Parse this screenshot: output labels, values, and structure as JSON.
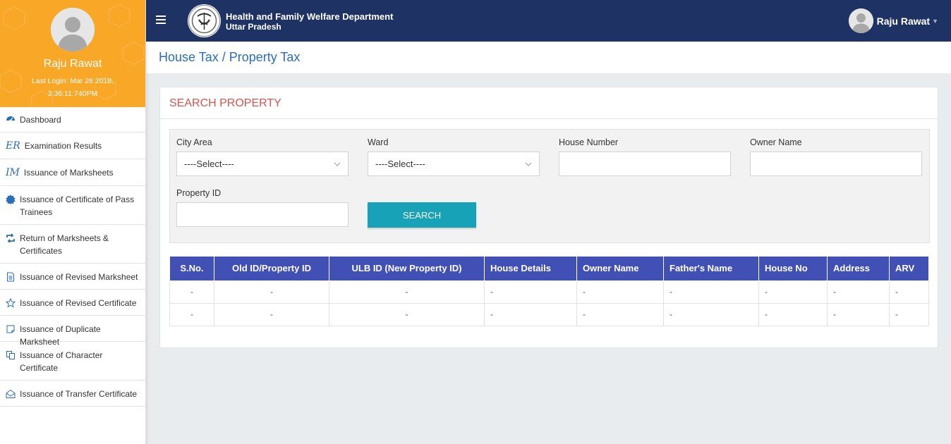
{
  "user": {
    "name": "Raju Rawat",
    "last_login": "Last Login: Mar 28 2018, 3:36:11:740PM"
  },
  "sidebar": {
    "items": [
      {
        "label": "Dashboard",
        "icon": "dashboard-icon"
      },
      {
        "label": "Examination Results",
        "icon": "er-icon",
        "icon_text": "ER"
      },
      {
        "label": "Issuance of Marksheets",
        "icon": "im-icon",
        "icon_text": "IM"
      },
      {
        "label": "Issuance of Certificate of Pass Trainees",
        "icon": "badge-icon"
      },
      {
        "label": "Return of Marksheets & Certificates",
        "icon": "retweet-icon"
      },
      {
        "label": "Issuance of Revised Marksheet",
        "icon": "document-icon"
      },
      {
        "label": "Issuance of Revised Certificate",
        "icon": "star-icon"
      },
      {
        "label": "Issuance of Duplicate Marksheet",
        "icon": "note-icon"
      },
      {
        "label": "Issuance of Character Certificate",
        "icon": "copy-icon"
      },
      {
        "label": "Issuance of Transfer Certificate",
        "icon": "envelope-open-icon"
      }
    ]
  },
  "header": {
    "dept_line1": "Health and Family Welfare Department",
    "dept_line2": "Uttar Pradesh"
  },
  "page": {
    "title": "House Tax / Property Tax"
  },
  "search": {
    "title": "SEARCH PROPERTY",
    "city_area_label": "City Area",
    "city_area_value": "----Select----",
    "ward_label": "Ward",
    "ward_value": "----Select----",
    "house_number_label": "House Number",
    "house_number_value": "",
    "owner_name_label": "Owner Name",
    "owner_name_value": "",
    "property_id_label": "Property ID",
    "property_id_value": "",
    "button_label": "SEARCH"
  },
  "table": {
    "headers": [
      "S.No.",
      "Old ID/Property ID",
      "ULB ID (New Property ID)",
      "House Details",
      "Owner Name",
      "Father's Name",
      "House No",
      "Address",
      "ARV"
    ],
    "rows": [
      [
        "-",
        "-",
        "-",
        "-",
        "-",
        "-",
        "-",
        "-",
        "-"
      ],
      [
        "-",
        "-",
        "-",
        "-",
        "-",
        "-",
        "-",
        "-",
        "-"
      ]
    ]
  },
  "colors": {
    "sidebar_profile_bg": "#f9a727",
    "topbar_bg": "#1e3364",
    "accent_blue": "#2a6ebb",
    "search_title": "#d9534f",
    "button_bg": "#17a2b8",
    "table_header_bg": "#4150b5"
  }
}
